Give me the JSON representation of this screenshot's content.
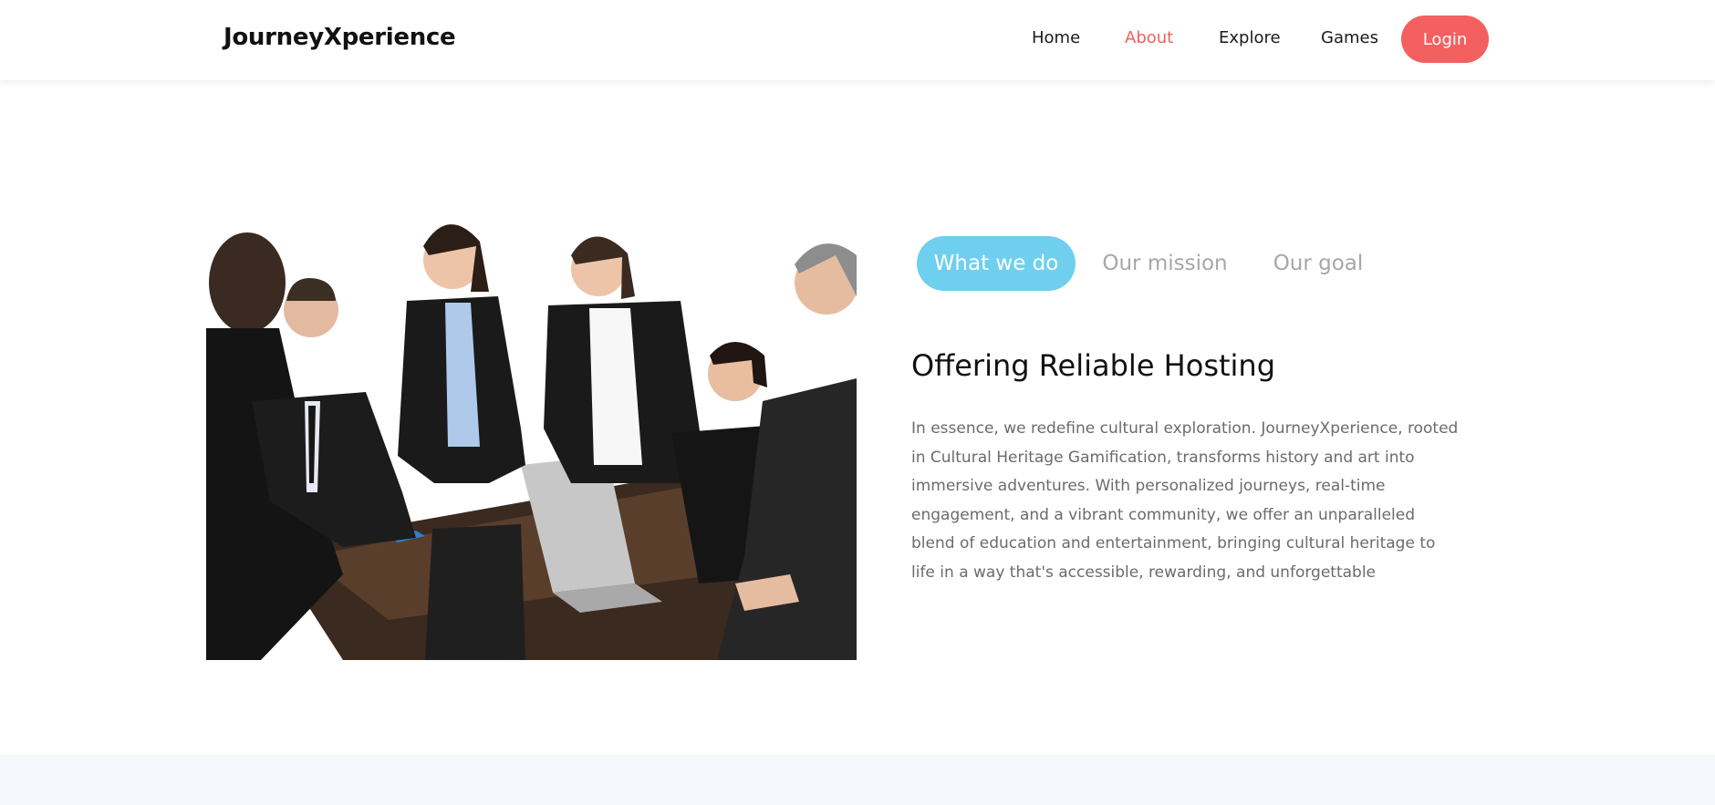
{
  "header": {
    "brand": "JourneyXperience",
    "nav": {
      "home": "Home",
      "about": "About",
      "explore": "Explore",
      "games": "Games",
      "login": "Login"
    }
  },
  "tabs": {
    "what_we_do": "What we do",
    "our_mission": "Our mission",
    "our_goal": "Our goal"
  },
  "content": {
    "title": "Offering Reliable Hosting",
    "body": "In essence, we redefine cultural exploration. JourneyXperience, rooted in Cultural Heritage Gamification, transforms history and art into immersive adventures. With personalized journeys, real-time engagement, and a vibrant community, we offer an unparalleled blend of education and entertainment, bringing cultural heritage to life in a way that's accessible, rewarding, and unforgettable"
  },
  "colors": {
    "accent": "#f45f5f",
    "tab_active": "#6fcfee",
    "text_muted": "#6b6b6b",
    "footer_band": "#f7f8fd"
  },
  "icons": {
    "hero_image": "business-meeting-photo"
  }
}
